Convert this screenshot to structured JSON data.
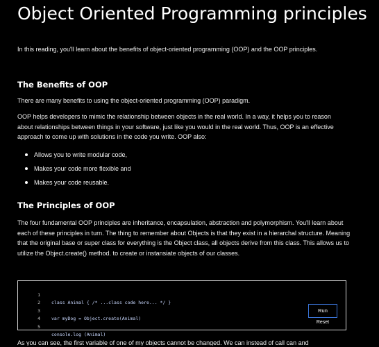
{
  "title": "Object Oriented Programming principles",
  "intro": "In this reading, you'll learn about the benefits of object-oriented programming (OOP) and the OOP principles.",
  "benefits": {
    "heading": "The Benefits of OOP",
    "lead": "There are many benefits to using the object-oriented programming (OOP) paradigm.",
    "body": "OOP helps developers to mimic the relationship between objects in the real world. In a way, it helps you to reason about relationships between things in your software, just like you would in the real world. Thus, OOP is an effective approach to come up with solutions in the code you write. OOP also:",
    "bullets": [
      "Allows you to write modular code,",
      "Makes your code more flexible and",
      "Makes your code reusable."
    ]
  },
  "principles": {
    "heading": "The Principles of OOP",
    "body": "The four fundamental OOP principles are inheritance, encapsulation, abstraction and polymorphism. You'll learn about each of these principles in turn. The thing to remember about Objects is that they exist in a hierarchal structure. Meaning that the original base or super class for everything is the Object class, all objects derive from this class. This allows us to utilize the Object.create() method. to create or instansiate objects of our classes."
  },
  "editor": {
    "lines": [
      {
        "num": "1",
        "code": "class Animal { /* ...class code here... */ }"
      },
      {
        "num": "2",
        "code": ""
      },
      {
        "num": "3",
        "code": "var myDog = Object.create(Animal)"
      },
      {
        "num": "4",
        "code": ""
      },
      {
        "num": "5",
        "code": "console.log (Animal)"
      }
    ],
    "run_label": "Run",
    "reset_label": "Reset"
  },
  "cut_off_text": "As you can see, the first variable of one of my objects cannot be changed. We can instead of call can and"
}
